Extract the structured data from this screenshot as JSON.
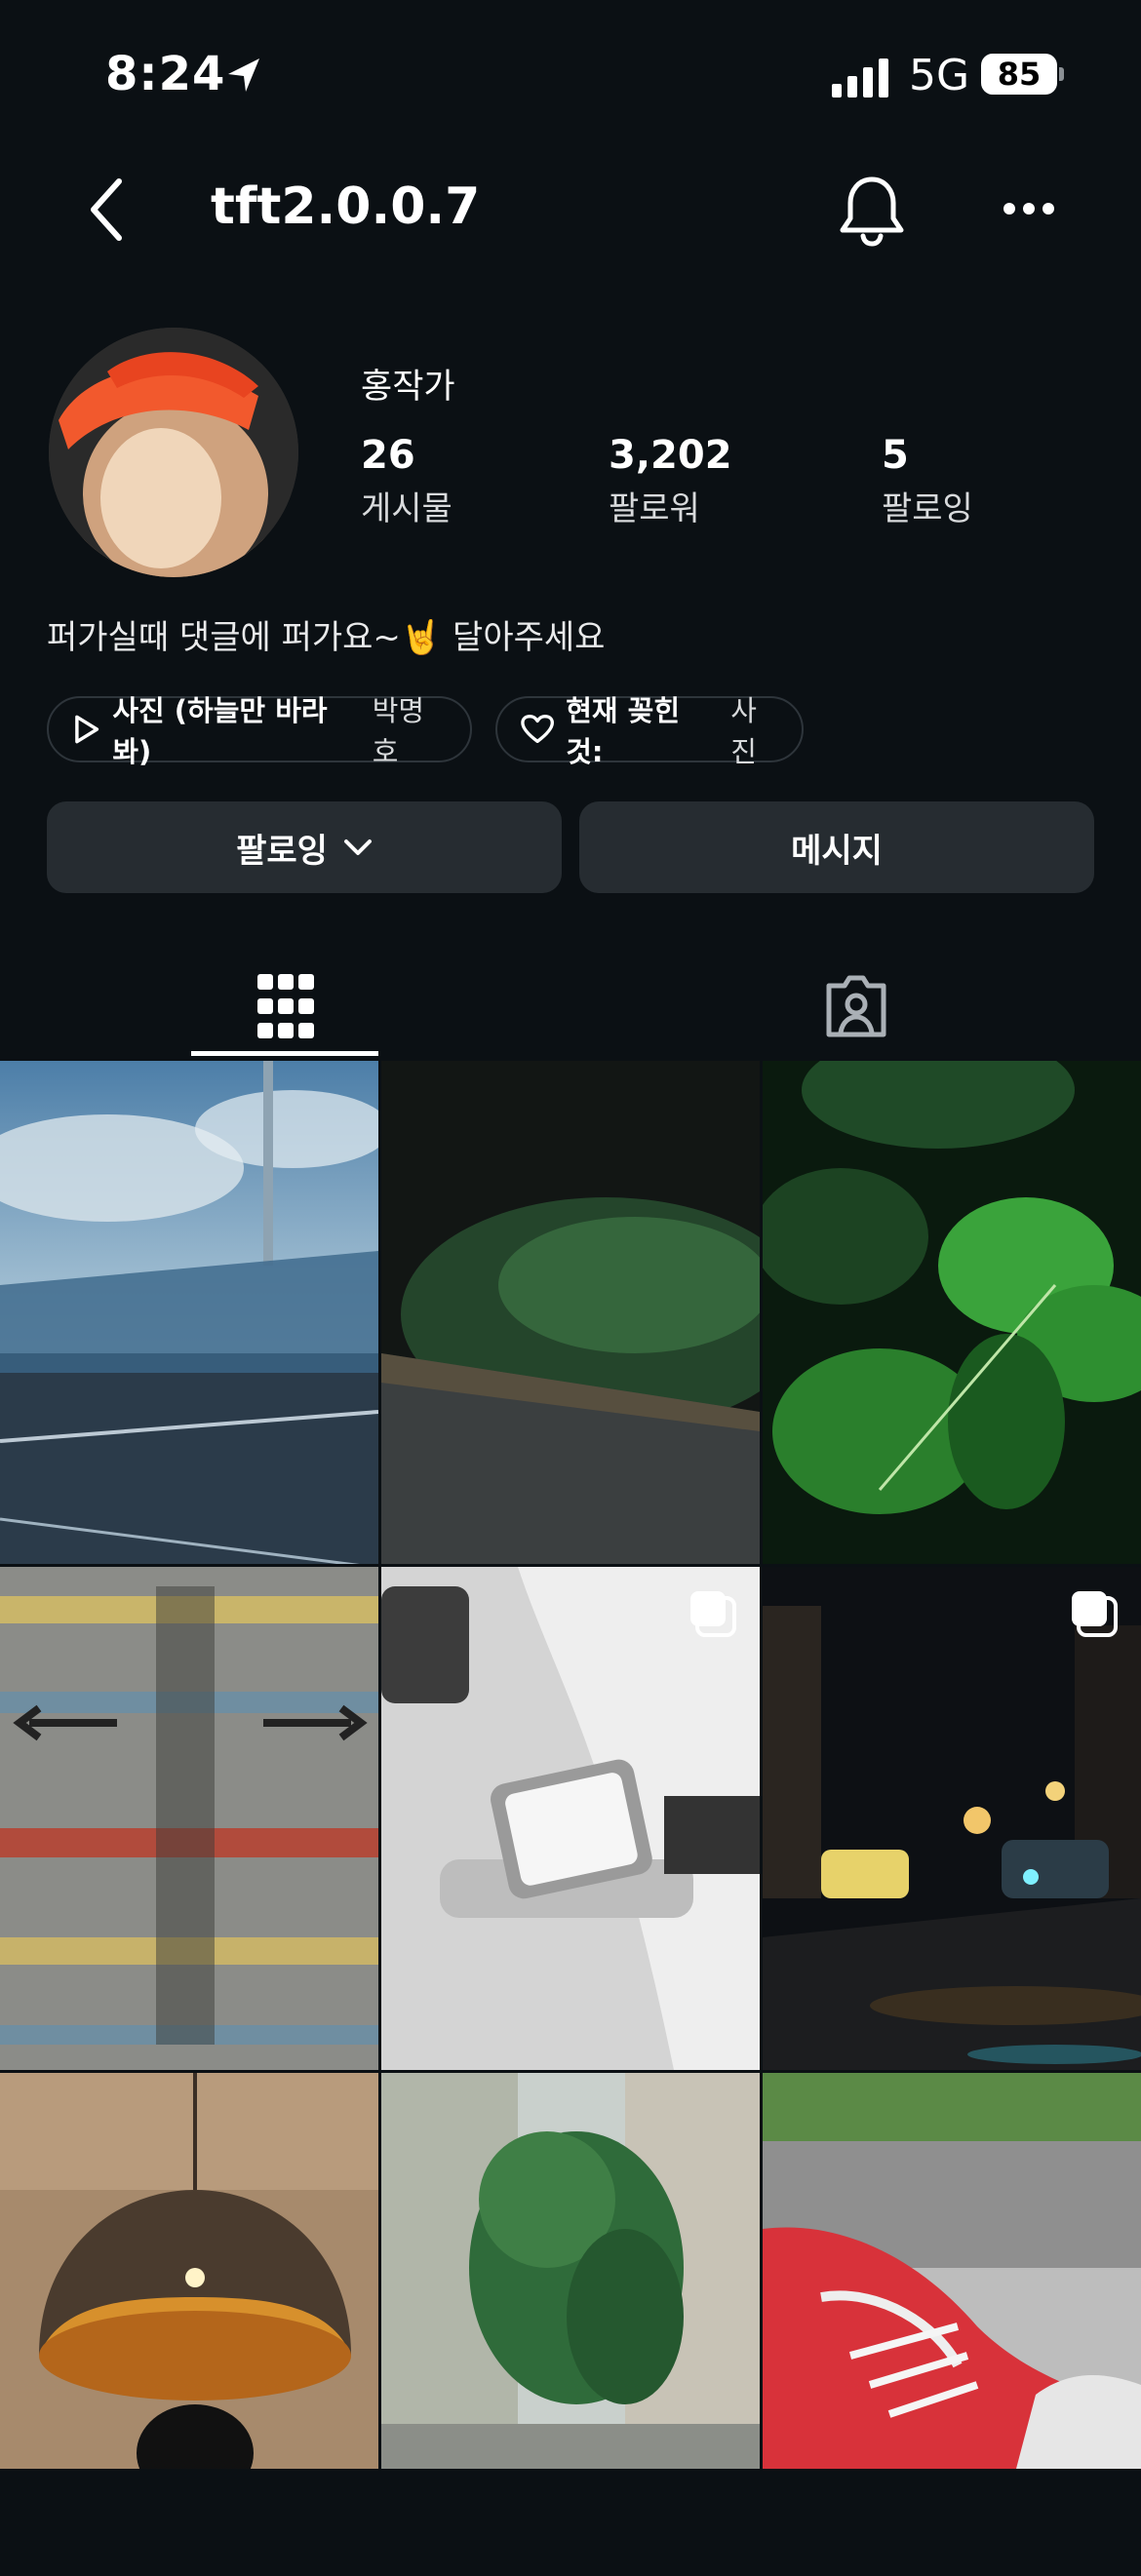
{
  "status_bar": {
    "time": "8:24",
    "network": "5G",
    "battery": "85"
  },
  "nav": {
    "username": "tft2.0.0.7"
  },
  "profile": {
    "display_name": "홍작가",
    "stats": [
      {
        "value": "26",
        "label": "게시물"
      },
      {
        "value": "3,202",
        "label": "팔로워"
      },
      {
        "value": "5",
        "label": "팔로잉"
      }
    ],
    "bio": "퍼가실때 댓글에 퍼가요~🤘 달아주세요",
    "chips": {
      "music_title": "사진 (하늘만 바라봐)",
      "music_artist": "박명호",
      "interest_label": "현재 꽂힌 것:",
      "interest_value": "사진"
    }
  },
  "actions": {
    "follow_label": "팔로잉",
    "message_label": "메시지"
  },
  "tabs": [
    "posts-grid",
    "tagged"
  ],
  "icons": [
    "back-icon",
    "bell-icon",
    "more-icon",
    "grid-icon",
    "tagged-icon",
    "play-icon",
    "heart-icon",
    "chevron-down-icon",
    "multi-photo-icon"
  ],
  "posts": [
    {
      "desc": "bridge-railing-sky"
    },
    {
      "desc": "dark-road-hill"
    },
    {
      "desc": "wet-green-leaves"
    },
    {
      "desc": "korean-shutter-sign"
    },
    {
      "desc": "wristwatch-bw",
      "multi": true
    },
    {
      "desc": "night-street-taxi",
      "multi": true
    },
    {
      "desc": "pendant-lamp"
    },
    {
      "desc": "alley-trees-buildings"
    },
    {
      "desc": "red-sneaker-grass"
    }
  ]
}
